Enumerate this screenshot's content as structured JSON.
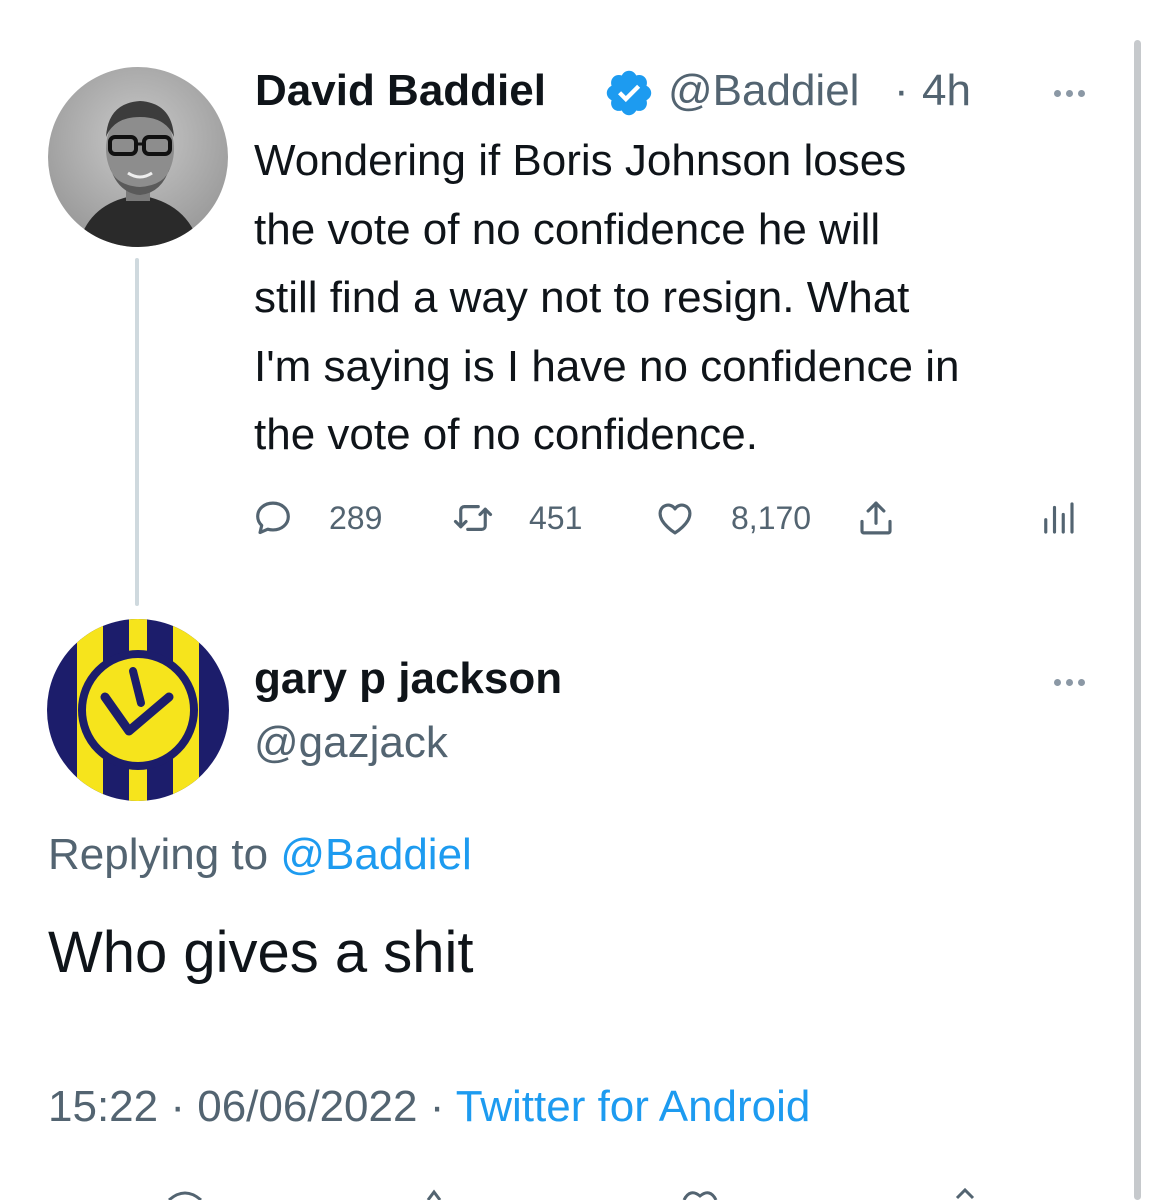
{
  "original_tweet": {
    "author_name": "David Baddiel",
    "handle": "@Baddiel",
    "separator": "·",
    "time_ago": "4h",
    "verified": true,
    "text": "Wondering if Boris Johnson loses\nthe vote of no confidence he will\nstill find a way not to resign. What\nI'm saying is I have no confidence in\nthe vote of no confidence.",
    "replies": "289",
    "retweets": "451",
    "likes": "8,170",
    "icons": [
      "comment-icon",
      "retweet-icon",
      "like-icon",
      "share-icon",
      "analytics-icon",
      "more-icon"
    ]
  },
  "reply_tweet": {
    "author_name": "gary p jackson",
    "handle": "@gazjack",
    "replying_label": "Replying to",
    "replying_to": "@Baddiel",
    "text": "Who gives a shit",
    "time": "15:22",
    "date": "06/06/2022",
    "source": "Twitter for Android",
    "separator": "·"
  },
  "colors": {
    "link": "#1d9bf0",
    "secondary_text": "#536471",
    "verified_badge": "#1d9bf0",
    "avatar_navy": "#1c1d6b",
    "avatar_yellow": "#f6e41c"
  }
}
